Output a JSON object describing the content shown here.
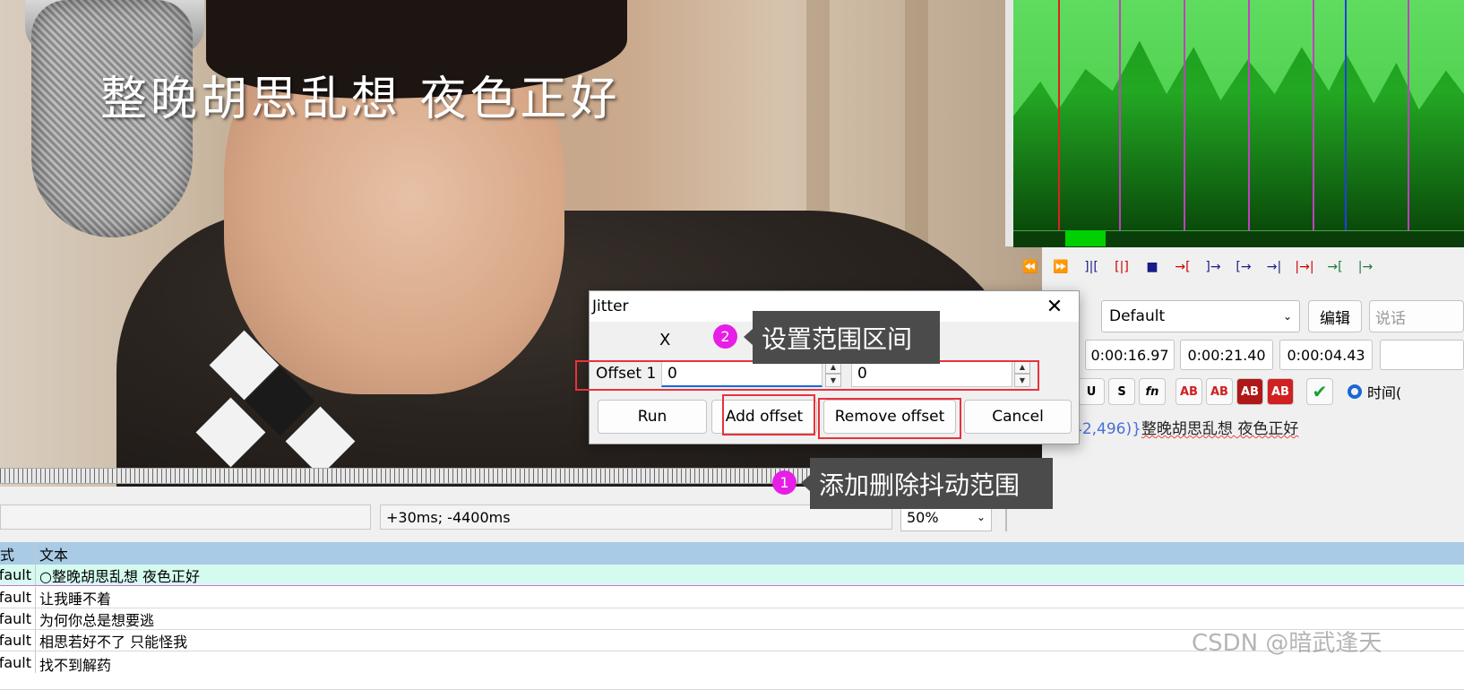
{
  "video": {
    "lyric": "整晚胡思乱想 夜色正好"
  },
  "audio": {
    "controls": [
      "⏪",
      "⏩",
      "]|[",
      "[|]",
      "■",
      "→[",
      "]→",
      "[→",
      "→|",
      "|→|",
      "→[",
      "|→"
    ]
  },
  "style_panel": {
    "style_value": "Default",
    "edit_button": "编辑",
    "actor_placeholder": "说话",
    "times": [
      "0:00:16.97",
      "0:00:21.40",
      "0:00:04.43"
    ],
    "format_buttons": [
      "U",
      "S",
      "fn",
      "AB",
      "AB",
      "AB",
      "AB"
    ],
    "time_radio_label": "时间(",
    "edit_text_tag": "42,496)}",
    "edit_text": "整晚胡思乱想 夜色正好"
  },
  "statusbar": {
    "offset_info": "+30ms; -4400ms",
    "zoom": "50%"
  },
  "grid": {
    "headers": {
      "style": "式",
      "text": "文本"
    },
    "rows": [
      {
        "style": "fault",
        "text": "整晚胡思乱想 夜色正好",
        "prefix": "○",
        "selected": true
      },
      {
        "style": "fault",
        "text": "让我睡不着",
        "prefix": "",
        "selected": false
      },
      {
        "style": "fault",
        "text": "为何你总是想要逃",
        "prefix": "",
        "selected": false
      },
      {
        "style": "fault",
        "text": "相思若好不了 只能怪我",
        "prefix": "",
        "selected": false
      },
      {
        "style": "fault",
        "text": "找不到解药",
        "prefix": "",
        "selected": false
      }
    ]
  },
  "dialog": {
    "title": "Jitter",
    "close": "✕",
    "column_x": "X",
    "offset_label": "Offset 1",
    "offset_x": "0",
    "offset_y": "0",
    "buttons": {
      "run": "Run",
      "add_offset": "Add offset",
      "remove_offset": "Remove offset",
      "cancel": "Cancel"
    }
  },
  "callouts": [
    {
      "number": "1",
      "text": "添加删除抖动范围"
    },
    {
      "number": "2",
      "text": "设置范围区间"
    }
  ],
  "watermark": "CSDN @暗武逢天",
  "colors": {
    "highlight_red": "#e8323c",
    "badge_magenta": "#e61ee6",
    "selected_row": "#d5fbf0",
    "grid_header": "#a9cbe5",
    "wave_green": "#4bcb4b"
  }
}
